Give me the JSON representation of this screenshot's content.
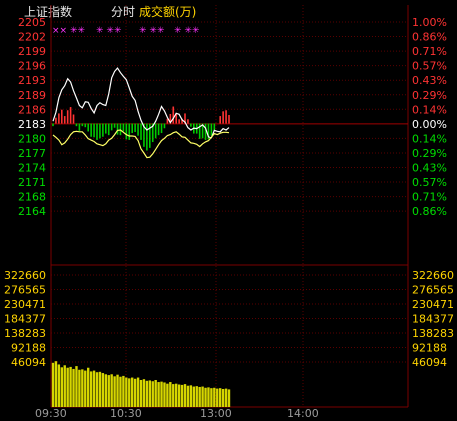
{
  "header": {
    "index_name": "上证指数",
    "mode": "分时",
    "volume_label": "成交额(万)"
  },
  "chart_data": {
    "type": "line",
    "title": "",
    "prev_close": 2183,
    "price_ticks": [
      2205,
      2202,
      2199,
      2196,
      2193,
      2189,
      2186,
      2183,
      2180,
      2177,
      2174,
      2171,
      2168,
      2164
    ],
    "pct_ticks": [
      "1.00%",
      "0.86%",
      "0.71%",
      "0.57%",
      "0.43%",
      "0.29%",
      "0.14%",
      "0.00%",
      "0.14%",
      "0.29%",
      "0.43%",
      "0.57%",
      "0.71%",
      "0.86%"
    ],
    "volume_ticks": [
      322660,
      276565,
      230471,
      184377,
      138283,
      92188,
      46094
    ],
    "x_ticks": [
      "09:30",
      "10:30",
      "13:00",
      "14:00"
    ],
    "price_range": [
      2164,
      2205
    ],
    "volume_range": [
      0,
      322660
    ],
    "series": [
      {
        "color": "#ffffff",
        "values": [
          2183.5,
          2185.4,
          2188.6,
          2190.3,
          2191.2,
          2192.7,
          2192.0,
          2190.1,
          2188.5,
          2186.9,
          2186.4,
          2187.7,
          2187.6,
          2186.3,
          2185.3,
          2186.9,
          2187.5,
          2187.1,
          2186.9,
          2189.4,
          2192.9,
          2194.3,
          2195.0,
          2194.0,
          2193.2,
          2192.5,
          2190.7,
          2188.9,
          2188.0,
          2185.6,
          2183.7,
          2182.3,
          2181.6,
          2182.0,
          2182.4,
          2183.5,
          2185.0,
          2186.7,
          2185.7,
          2184.3,
          2183.2,
          2184.1,
          2185.2,
          2185.0,
          2183.8,
          2183.3,
          2182.1,
          2181.6,
          2182.0,
          2181.9,
          2182.3,
          2182.7,
          2182.0,
          2180.1,
          2179.9,
          2181.5,
          2181.3,
          2181.2,
          2181.9,
          2181.6,
          2182.1
        ]
      },
      {
        "color": "#ffff66",
        "values": [
          2180.5,
          2180.0,
          2179.4,
          2178.4,
          2178.8,
          2179.6,
          2180.6,
          2181.2,
          2181.3,
          2181.2,
          2181.2,
          2180.5,
          2179.7,
          2179.4,
          2179.1,
          2178.6,
          2178.4,
          2178.2,
          2178.6,
          2179.4,
          2179.8,
          2180.6,
          2181.5,
          2181.6,
          2181.1,
          2180.6,
          2180.3,
          2180.3,
          2180.2,
          2179.3,
          2177.5,
          2176.6,
          2175.6,
          2175.7,
          2176.4,
          2177.4,
          2178.4,
          2179.3,
          2179.8,
          2180.4,
          2180.6,
          2181.0,
          2181.2,
          2180.7,
          2180.1,
          2180.0,
          2179.4,
          2178.8,
          2178.7,
          2178.5,
          2178.0,
          2178.6,
          2179.0,
          2179.3,
          2180.0,
          2180.8,
          2180.6,
          2180.9,
          2181.1,
          2181.1,
          2181.0
        ]
      }
    ],
    "change_bars": [
      -0.5,
      1.1,
      1.9,
      2.6,
      1.4,
      2.5,
      3.1,
      1.7,
      -0.5,
      -1.4,
      -0.5,
      -0.7,
      -1.5,
      -2.5,
      -2.6,
      -3.1,
      -2.8,
      -2.5,
      -1.9,
      -2.2,
      -1.3,
      -0.8,
      -2.1,
      -2.2,
      -1.5,
      -3.0,
      -3.1,
      -1.8,
      -1.6,
      -2.3,
      -3.1,
      -4.4,
      -5.1,
      -4.6,
      -3.5,
      -2.8,
      -2.2,
      -1.8,
      -0.9,
      0.9,
      1.8,
      3.2,
      2.0,
      0.8,
      0.9,
      1.9,
      0.8,
      -0.6,
      -1.9,
      -1.9,
      -2.9,
      -2.8,
      -3.1,
      -3.0,
      -2.3,
      -1.3,
      0.0,
      1.4,
      2.3,
      2.5,
      1.6
    ],
    "volume": [
      108000,
      112000,
      104000,
      97000,
      102000,
      96000,
      98000,
      93000,
      100000,
      91000,
      92000,
      89000,
      96000,
      87000,
      89000,
      85000,
      86000,
      83000,
      80000,
      78000,
      80000,
      75000,
      79000,
      74000,
      76000,
      72000,
      70000,
      72000,
      69000,
      72000,
      66000,
      68000,
      64000,
      65000,
      63000,
      66000,
      61000,
      62000,
      60000,
      57000,
      61000,
      56000,
      57000,
      55000,
      54000,
      56000,
      52000,
      53000,
      50000,
      51000,
      49000,
      50000,
      47000,
      48000,
      46000,
      47000,
      45000,
      46000,
      44000,
      45000,
      43000
    ]
  },
  "markers": [
    "×× ✳✳",
    "✳ ✳✳",
    "✳ ✳✳",
    "✳ ✳✳"
  ]
}
